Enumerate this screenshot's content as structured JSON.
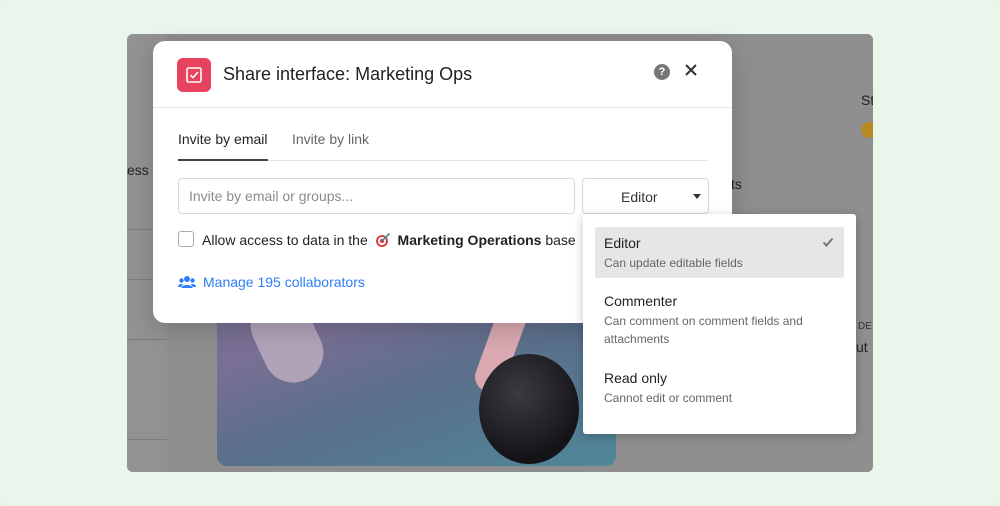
{
  "dialog": {
    "title": "Share interface: Marketing Ops",
    "help_icon": "?",
    "tabs": [
      {
        "label": "Invite by email",
        "active": true
      },
      {
        "label": "Invite by link",
        "active": false
      }
    ],
    "email_input": {
      "value": "",
      "placeholder": "Invite by email or groups..."
    },
    "role_select": {
      "selected": "Editor"
    },
    "allow_access": {
      "checked": false,
      "prefix": "Allow access to data in the",
      "base_name": "Marketing Operations",
      "suffix": "base"
    },
    "manage_link": "Manage 195 collaborators"
  },
  "role_dropdown": {
    "options": [
      {
        "title": "Editor",
        "description": "Can update editable fields",
        "selected": true
      },
      {
        "title": "Commenter",
        "description": "Can comment on comment fields and attachments",
        "selected": false
      },
      {
        "title": "Read only",
        "description": "Cannot edit or comment",
        "selected": false
      }
    ]
  },
  "background": {
    "left_text": "ess",
    "right_text_1": "St",
    "right_text_2": "ts",
    "right_text_3": "DE",
    "right_text_4": "ut"
  },
  "colors": {
    "page_bg": "#eaf5ec",
    "app_icon": "#e8435e",
    "link": "#2d7ff9",
    "selected_option_bg": "#e6e6e6"
  },
  "icons": {
    "app_icon": "checkbox-square-icon",
    "close": "close-icon",
    "help": "question-circle-icon",
    "manage": "people-icon",
    "base_emoji": "target-dart-icon",
    "check": "checkmark-icon"
  }
}
